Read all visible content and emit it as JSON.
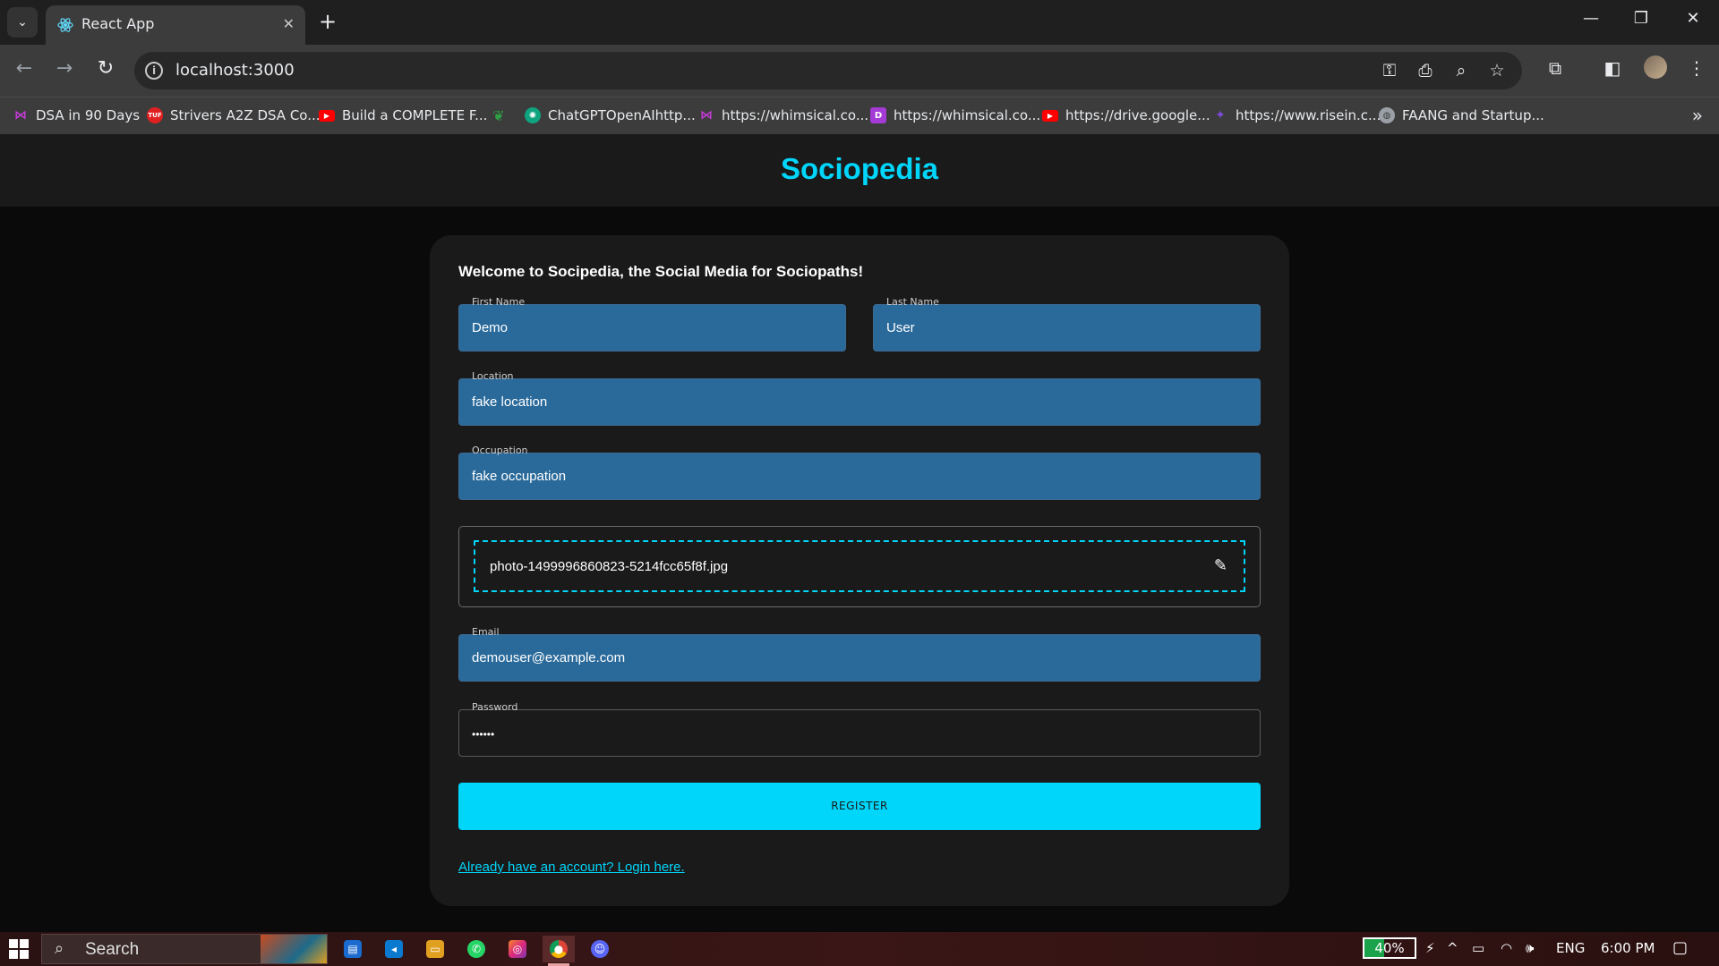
{
  "browser": {
    "tab_title": "React App",
    "url": "localhost:3000",
    "bookmarks": [
      {
        "label": "DSA in 90 Days",
        "icon": "whimsical-icon",
        "color": "#c23bd4"
      },
      {
        "label": "Strivers A2Z DSA Co...",
        "icon": "tuf-icon",
        "color": "#e02020"
      },
      {
        "label": "Build a COMPLETE F...",
        "icon": "youtube-icon",
        "color": "#ff0000"
      },
      {
        "label": "",
        "icon": "leaf-icon",
        "color": "#2ea043"
      },
      {
        "label": "ChatGPTOpenAIhttp...",
        "icon": "chatgpt-icon",
        "color": "#10a37f"
      },
      {
        "label": "https://whimsical.co...",
        "icon": "whimsical-icon",
        "color": "#c23bd4"
      },
      {
        "label": "https://whimsical.co...",
        "icon": "d-icon",
        "color": "#a33bd4"
      },
      {
        "label": "https://drive.google...",
        "icon": "youtube-icon",
        "color": "#ff0000"
      },
      {
        "label": "https://www.risein.c...",
        "icon": "risein-icon",
        "color": "#7b4ad6"
      },
      {
        "label": "FAANG and Startup...",
        "icon": "globe-icon",
        "color": "#9aa0a6"
      }
    ]
  },
  "app": {
    "brand": "Sociopedia",
    "welcome": "Welcome to Socipedia, the Social Media for Sociopaths!",
    "form": {
      "first_name": {
        "label": "First Name",
        "value": "Demo"
      },
      "last_name": {
        "label": "Last Name",
        "value": "User"
      },
      "location": {
        "label": "Location",
        "value": "fake location"
      },
      "occupation": {
        "label": "Occupation",
        "value": "fake occupation"
      },
      "picture": {
        "filename": "photo-1499996860823-5214fcc65f8f.jpg"
      },
      "email": {
        "label": "Email",
        "value": "demouser@example.com"
      },
      "password": {
        "label": "Password",
        "value": "••••••"
      },
      "register_label": "REGISTER",
      "login_link": "Already have an account? Login here."
    }
  },
  "taskbar": {
    "search_placeholder": "Search",
    "battery": "40%",
    "battery_level": 0.4,
    "language": "ENG",
    "time": "6:00 PM"
  },
  "colors": {
    "accent": "#00d5fa",
    "field_bg": "#2a6a9a",
    "card_bg": "#1a1a1a"
  }
}
